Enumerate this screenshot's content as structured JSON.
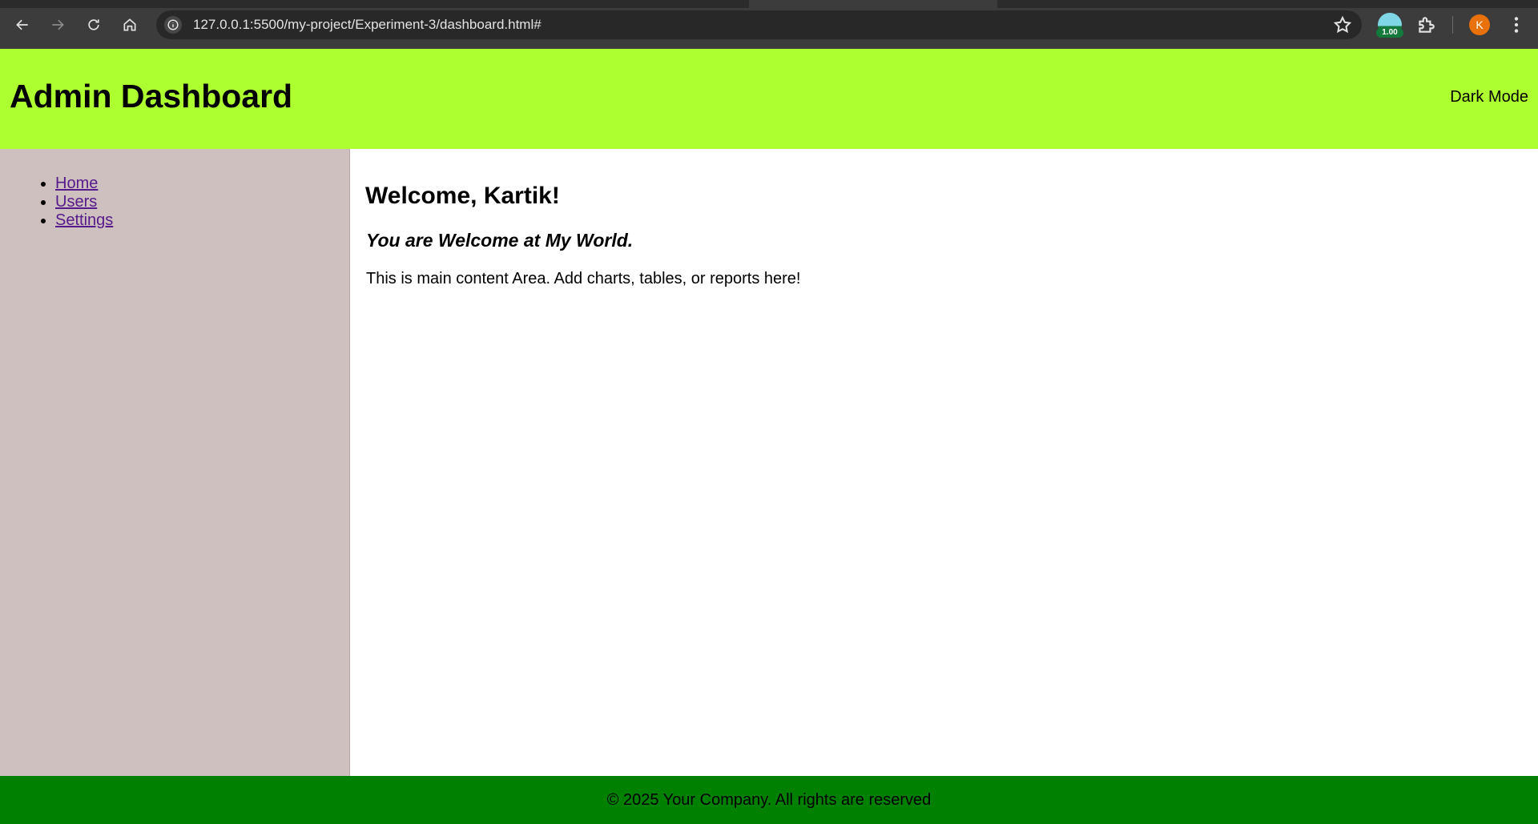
{
  "browser": {
    "url": "127.0.0.1:5500/my-project/Experiment-3/dashboard.html#",
    "extension_badge": "1.00",
    "profile_initial": "K"
  },
  "header": {
    "title": "Admin Dashboard",
    "dark_mode_label": "Dark Mode",
    "background": "#adff2f"
  },
  "sidebar": {
    "items": [
      {
        "label": "Home"
      },
      {
        "label": "Users"
      },
      {
        "label": "Settings"
      }
    ],
    "background": "#cfc0c0"
  },
  "main": {
    "welcome": "Welcome, Kartik!",
    "subtitle": "You are Welcome at My World.",
    "body": "This is main content Area. Add charts, tables, or reports here!"
  },
  "footer": {
    "text": "© 2025 Your Company. All rights are reserved",
    "background": "#008000"
  }
}
